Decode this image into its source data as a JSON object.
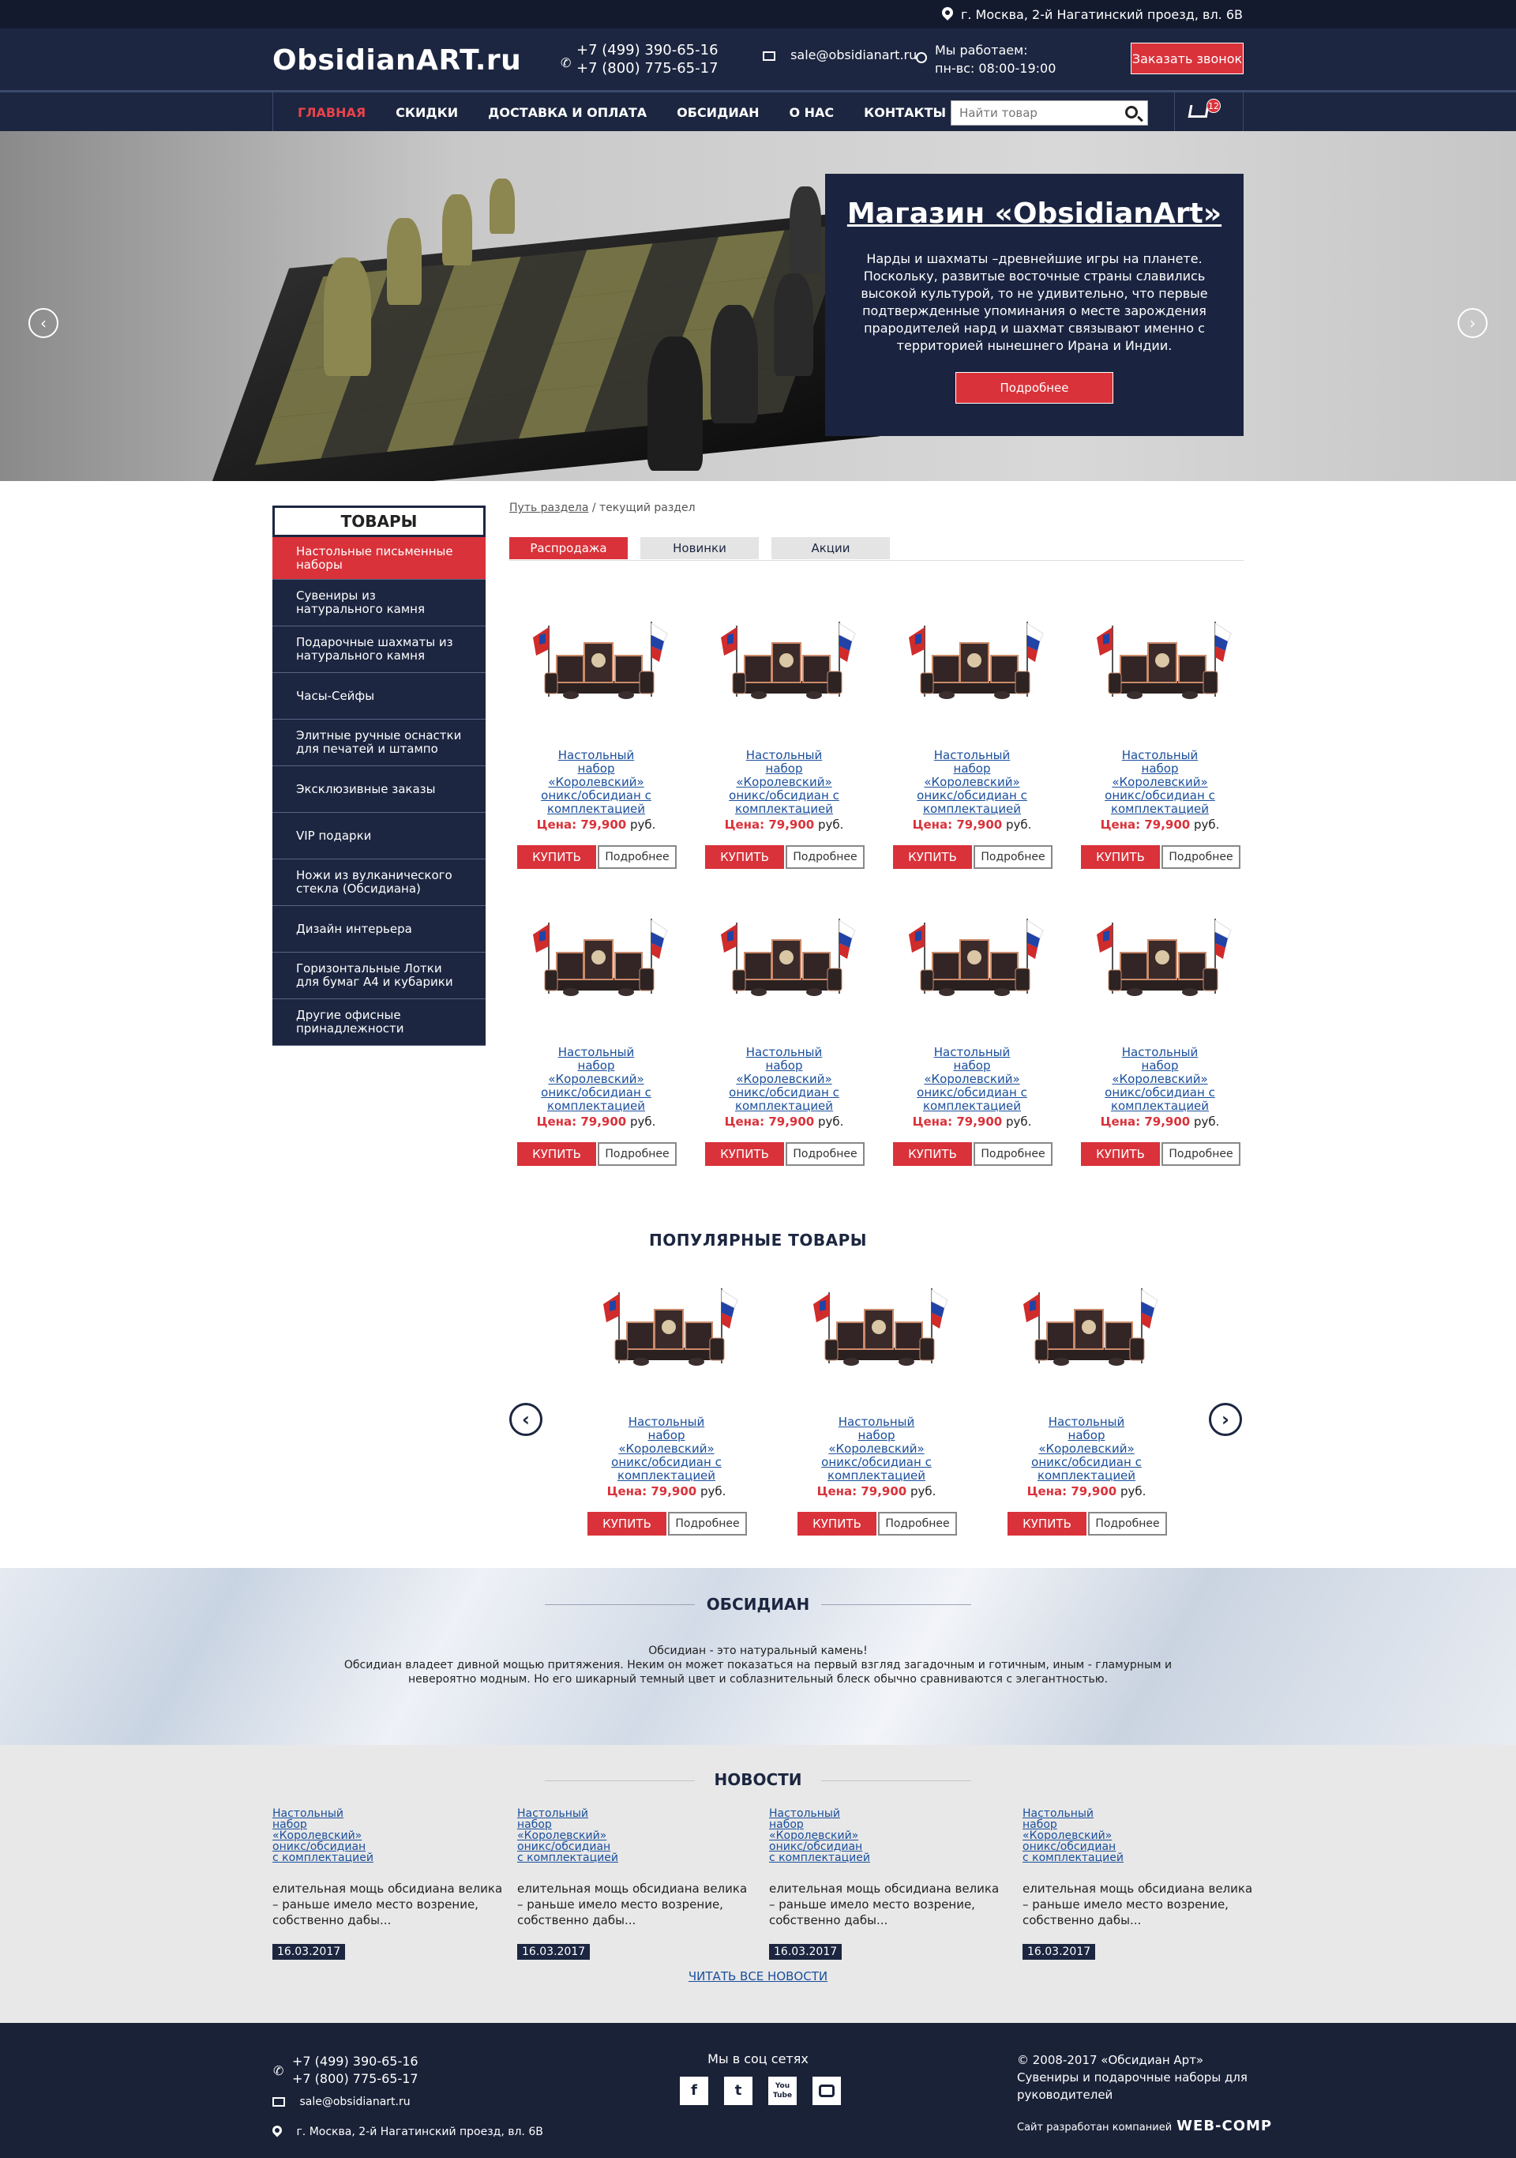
{
  "topbar": {
    "address": "г. Москва, 2-й Нагатинский проезд, вл. 6В"
  },
  "header": {
    "logo": "ObsidianART.ru",
    "phone1": "+7 (499) 390-65-16",
    "phone2": "+7 (800) 775-65-17",
    "email": "sale@obsidianart.ru",
    "hours_label": "Мы работаем:",
    "hours_value": "пн-вс: 08:00-19:00",
    "callback_button": "Заказать звонок"
  },
  "nav": {
    "items": [
      "ГЛАВНАЯ",
      "СКИДКИ",
      "ДОСТАВКА И ОПЛАТА",
      "ОБСИДИАН",
      "О НАС",
      "КОНТАКТЫ"
    ],
    "search_placeholder": "Найти товар",
    "cart_count": "12"
  },
  "hero": {
    "title": "Магазин «ObsidianArt»",
    "text": "Нарды и шахматы –древнейшие игры на планете. Поскольку, развитые восточные страны славились высокой культурой, то не удивительно, что первые подтвержденные упоминания о месте зарождения прародителей нард и шахмат связывают именно с территорией нынешнего Ирана и Индии.",
    "button": "Подробнее"
  },
  "sidebar": {
    "title": "ТОВАРЫ",
    "items": [
      "Настольные письменные наборы",
      "Сувениры из натурального камня",
      "Подарочные шахматы из натурального камня",
      "Часы-Сейфы",
      "Элитные ручные оснастки для печатей и штампо",
      "Эксклюзивные заказы",
      "VIP подарки",
      "Ножи из вулканического стекла (Обсидиана)",
      "Дизайн интерьера",
      "Горизонтальные Лотки для бумаг А4 и кубарики",
      "Другие офисные принадлежности"
    ]
  },
  "breadcrumb": {
    "path_link": "Путь раздела",
    "separator": " / ",
    "current": "текущий раздел"
  },
  "tabs": [
    "Распродажа",
    "Новинки",
    "Акции"
  ],
  "product": {
    "name": "Настольный набор «Королевский» оникс/обсидиан с комплектацией",
    "price_label": "Цена: 79,900",
    "price_currency": " руб.",
    "buy": "КУПИТЬ",
    "more": "Подробнее"
  },
  "popular": {
    "title": "ПОПУЛЯРНЫЕ ТОВАРЫ"
  },
  "obsidian": {
    "title": "ОБСИДИАН",
    "line1": "Обсидиан - это натуральный камень!",
    "line2": "Обсидиан владеет дивной мощью притяжения. Неким он может показаться на первый взгляд загадочным и готичным, иным - гламурным и",
    "line3": "невероятно модным. Но его шикарный темный цвет и соблазнительный блеск обычно сравниваются с элегантностью."
  },
  "news": {
    "title": "НОВОСТИ",
    "item_title": "Настольный набор «Королевский» оникс/обсидиан с комплектацией",
    "item_text": "елительная мощь обсидиана велика – раньше имело место возрение, собственно дабы...",
    "item_date": "16.03.2017",
    "read_all": "ЧИТАТЬ ВСЕ НОВОСТИ"
  },
  "footer": {
    "phone1": "+7 (499) 390-65-16",
    "phone2": "+7 (800) 775-65-17",
    "email": "sale@obsidianart.ru",
    "address": "г. Москва, 2-й Нагатинский проезд, вл. 6В",
    "social_title": "Мы в соц сетях",
    "socials": [
      "f",
      "t",
      "You Tube",
      "instagram"
    ],
    "copyright": "© 2008-2017 «Обсидиан Арт»",
    "tagline": "Сувениры и подарочные наборы для руководителей",
    "dev_label": "Сайт разработан компанией",
    "dev_name": "WEB-COMP"
  },
  "colors": {
    "accent": "#d9323a",
    "navy": "#1c2640",
    "footer": "#1a2238"
  }
}
